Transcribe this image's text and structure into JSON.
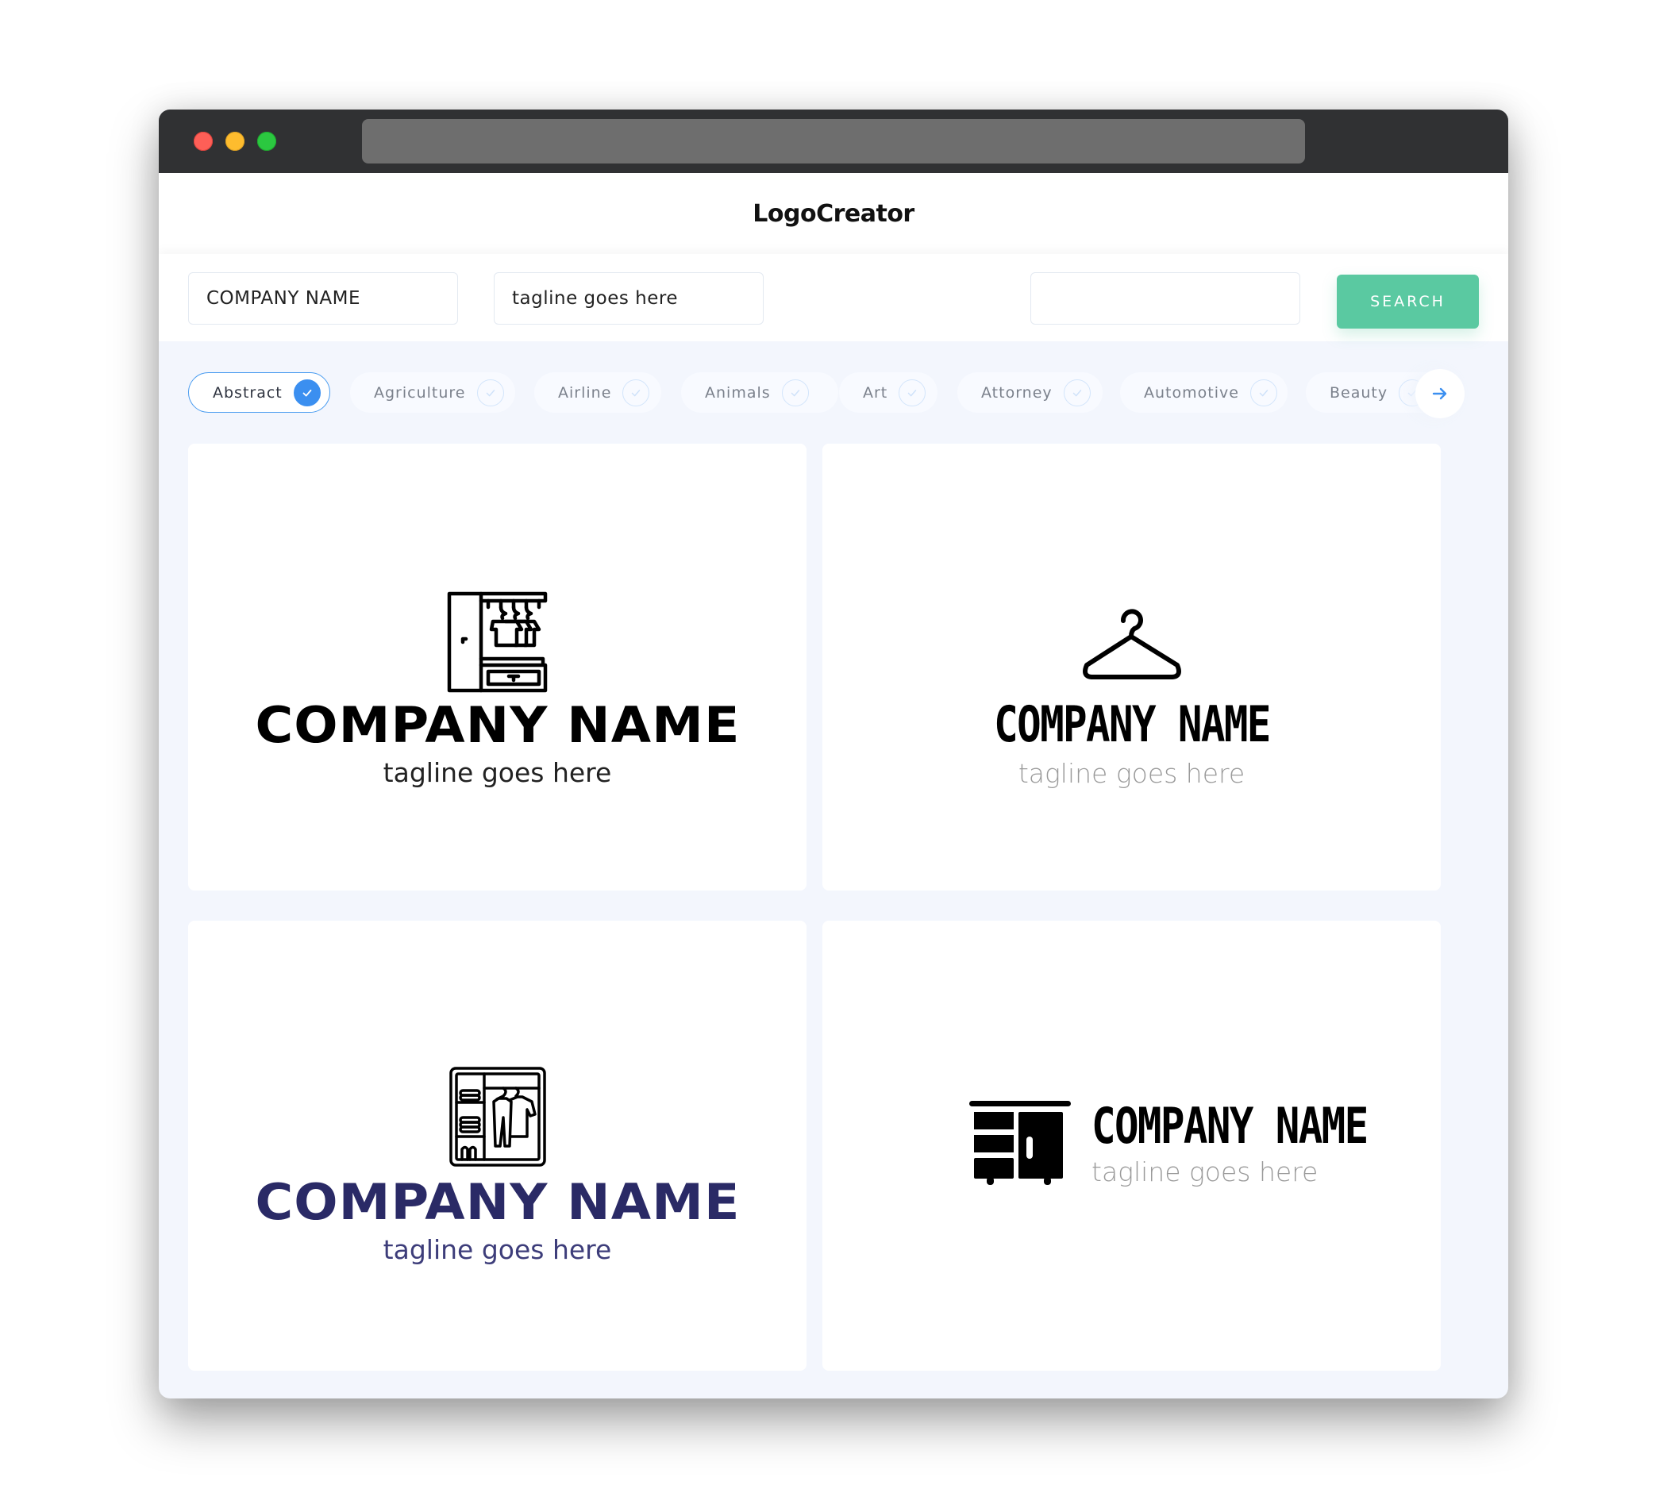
{
  "app": {
    "title": "LogoCreator",
    "window_controls": [
      "close",
      "minimize",
      "maximize"
    ]
  },
  "search": {
    "company_name_value": "COMPANY NAME",
    "tagline_value": "tagline goes here",
    "keyword_value": "",
    "button_label": "SEARCH"
  },
  "categories": [
    {
      "label": "Abstract",
      "selected": true
    },
    {
      "label": "Agriculture",
      "selected": false
    },
    {
      "label": "Airline",
      "selected": false
    },
    {
      "label": "Animals",
      "selected": false
    },
    {
      "label": "Art",
      "selected": false
    },
    {
      "label": "Attorney",
      "selected": false
    },
    {
      "label": "Automotive",
      "selected": false
    },
    {
      "label": "Beauty",
      "selected": false
    }
  ],
  "colors": {
    "accent_green": "#5ac9a1",
    "accent_blue": "#3b8ff0",
    "navy": "#2a2a66",
    "titlebar": "#303133"
  },
  "logos": [
    {
      "icon": "wardrobe-with-shirts-icon",
      "company_name": "COMPANY NAME",
      "tagline": "tagline goes here",
      "name_color": "#000000",
      "tagline_color": "#222222"
    },
    {
      "icon": "clothes-hanger-icon",
      "company_name": "COMPANY NAME",
      "tagline": "tagline goes here",
      "name_color": "#000000",
      "tagline_color": "#9a9a9a"
    },
    {
      "icon": "open-closet-icon",
      "company_name": "COMPANY NAME",
      "tagline": "tagline goes here",
      "name_color": "#2a2a66",
      "tagline_color": "#3d3d7a"
    },
    {
      "icon": "cabinet-drawers-icon",
      "company_name": "COMPANY NAME",
      "tagline": "tagline goes here",
      "name_color": "#000000",
      "tagline_color": "#9a9a9a"
    }
  ]
}
